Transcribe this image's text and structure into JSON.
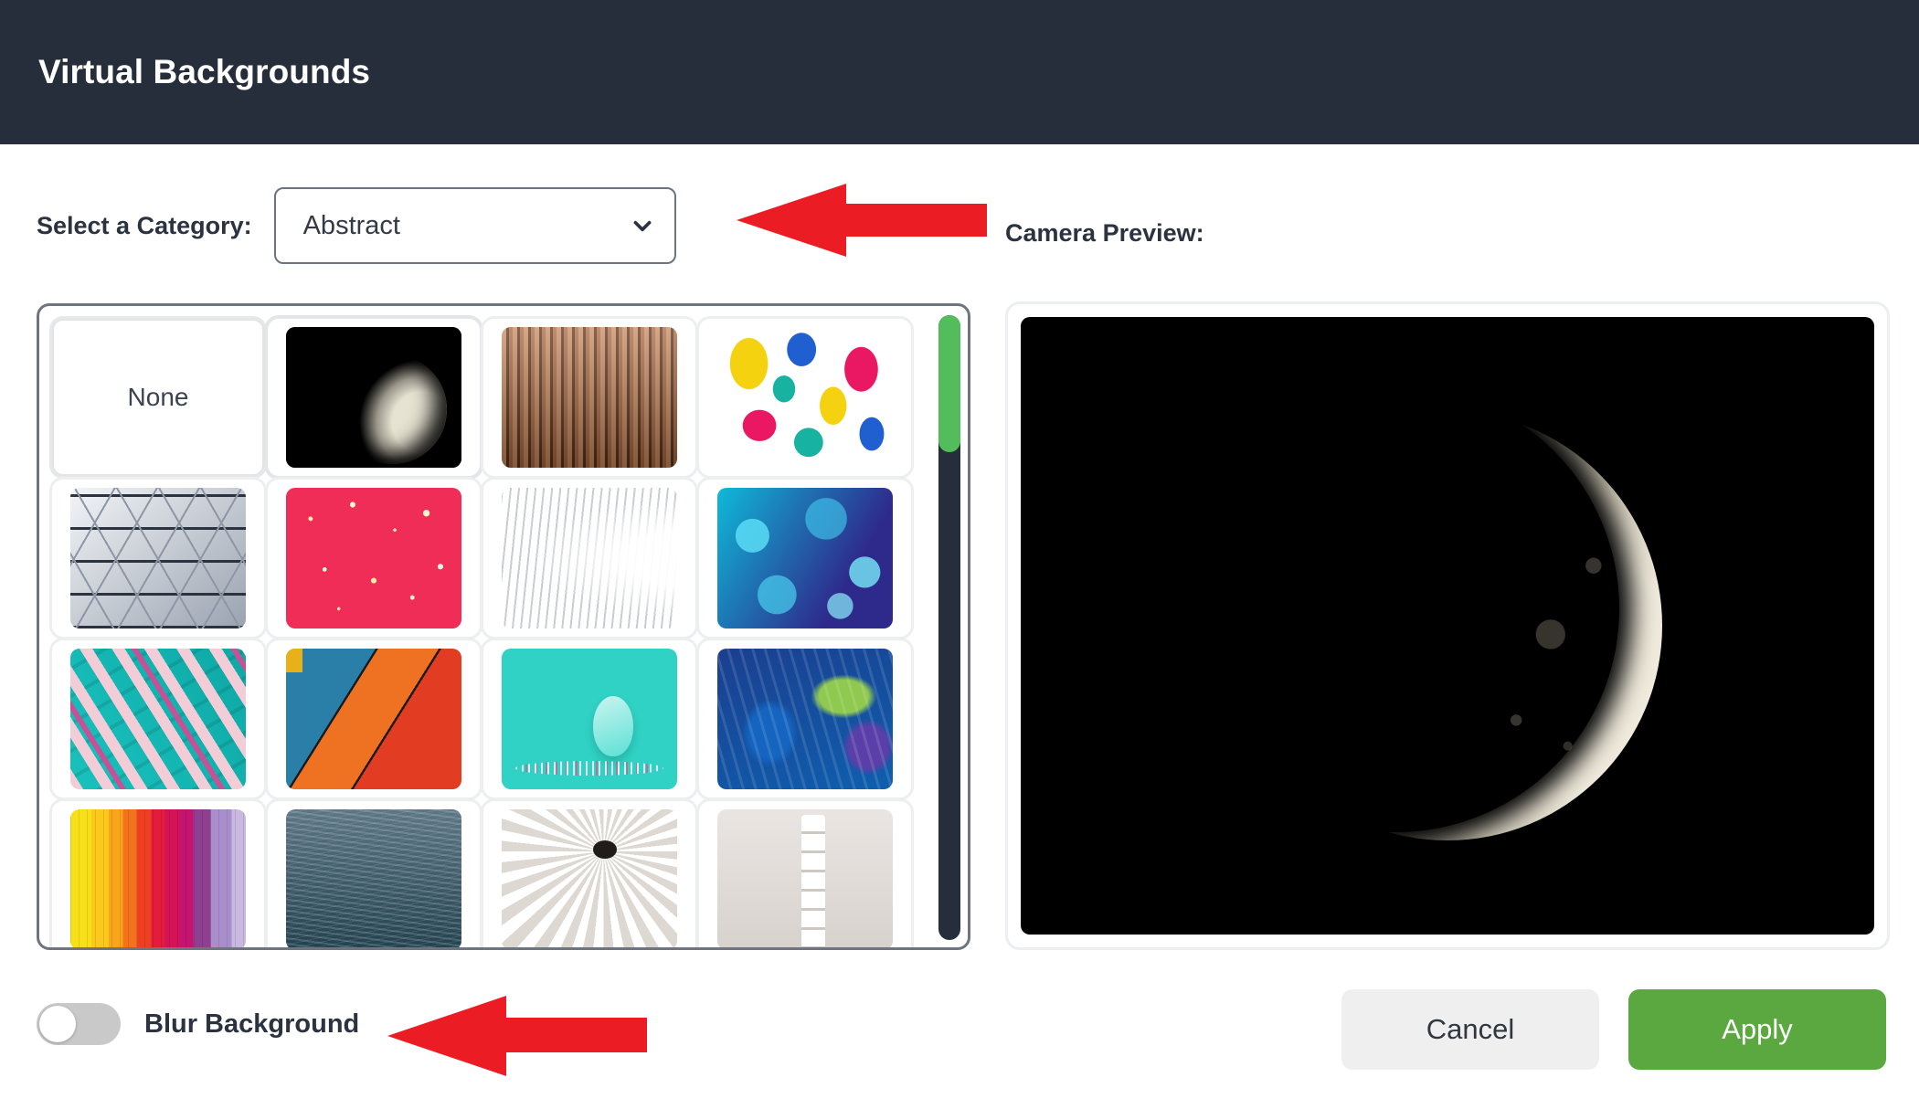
{
  "header": {
    "title": "Virtual Backgrounds",
    "bg_color": "#262E3B"
  },
  "category": {
    "label": "Select a Category:",
    "selected": "Abstract",
    "chevron_icon": "chevron-down-icon"
  },
  "preview": {
    "label": "Camera Preview:",
    "content": "crescent-moon-on-black"
  },
  "grid": {
    "none_label": "None",
    "selected_index": 1,
    "scrollbar": {
      "thumb_color": "#52BD5A",
      "track_color": "#262E3B",
      "thumb_position": "top"
    },
    "thumbnails": [
      {
        "name": "none",
        "art": "none",
        "label": "None"
      },
      {
        "name": "crescent-moon",
        "art": "a-moon",
        "label": ""
      },
      {
        "name": "copper-stripes",
        "art": "a-stripes",
        "label": ""
      },
      {
        "name": "colorful-paint-splash",
        "art": "a-paint",
        "label": ""
      },
      {
        "name": "geometric-triangles",
        "art": "a-geo",
        "label": ""
      },
      {
        "name": "pink-glitter",
        "art": "a-glitter",
        "label": ""
      },
      {
        "name": "white-curved-architecture",
        "art": "a-arch",
        "label": ""
      },
      {
        "name": "blue-bokeh",
        "art": "a-bokeh",
        "label": ""
      },
      {
        "name": "teal-pink-shards",
        "art": "a-shards",
        "label": ""
      },
      {
        "name": "orange-blue-diagonal-bands",
        "art": "a-bands",
        "label": ""
      },
      {
        "name": "teal-glitter-egg",
        "art": "a-egg",
        "label": ""
      },
      {
        "name": "blue-textured-paint",
        "art": "a-bluepaint",
        "label": ""
      },
      {
        "name": "rainbow-stripes",
        "art": "a-rainbow",
        "label": ""
      },
      {
        "name": "ocean-waves",
        "art": "a-ocean",
        "label": ""
      },
      {
        "name": "white-spiral",
        "art": "a-spiral",
        "label": ""
      },
      {
        "name": "white-cubes",
        "art": "a-cubes",
        "label": ""
      }
    ]
  },
  "blur": {
    "label": "Blur Background",
    "enabled": false
  },
  "actions": {
    "cancel_label": "Cancel",
    "apply_label": "Apply",
    "apply_color": "#5aa83f"
  },
  "annotations": {
    "arrow_color": "#EC1C24",
    "arrow_category_target": "category-dropdown",
    "arrow_blur_target": "blur-background-toggle"
  }
}
